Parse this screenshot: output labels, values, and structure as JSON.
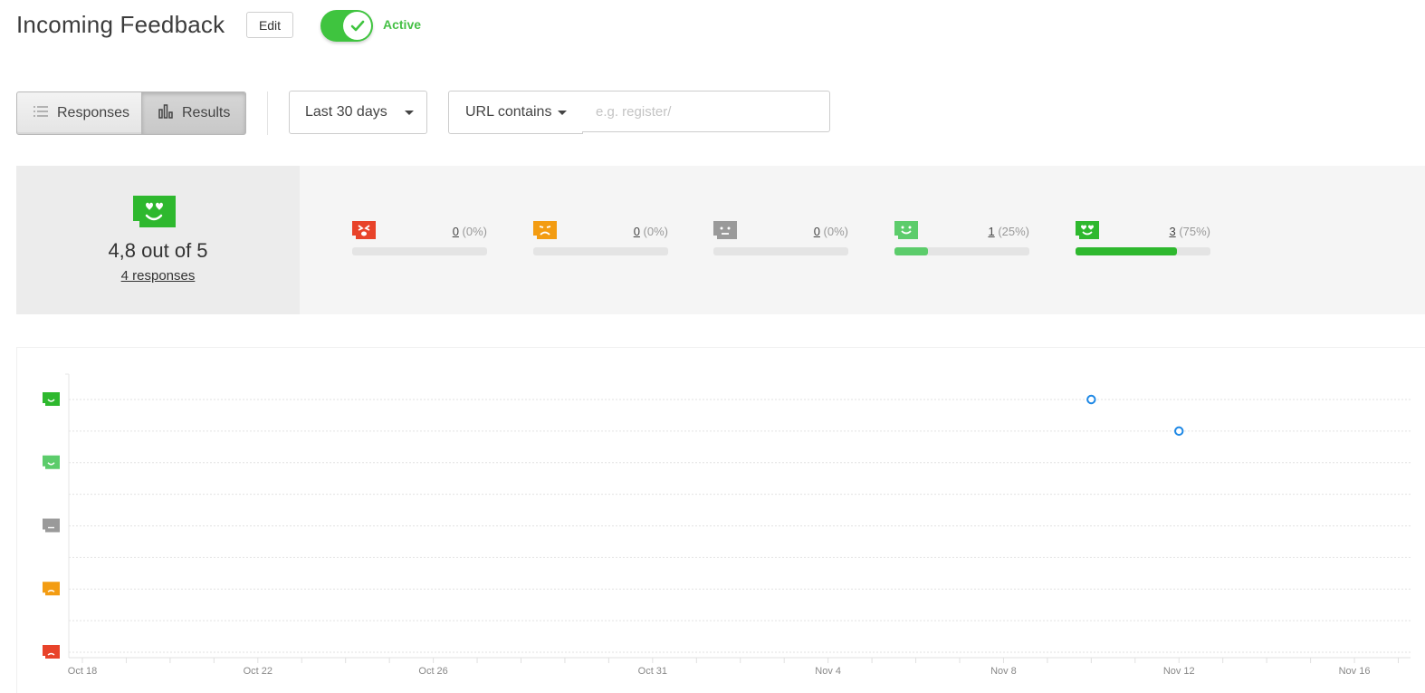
{
  "header": {
    "title": "Incoming Feedback",
    "edit_label": "Edit",
    "status_label": "Active",
    "active_color": "#3fc43f"
  },
  "toolbar": {
    "responses_tab": "Responses",
    "results_tab": "Results",
    "date_range": "Last 30 days",
    "url_filter": "URL contains",
    "url_placeholder": "e.g. register/"
  },
  "summary": {
    "average": "4,8",
    "average_suffix": "out of 5",
    "responses_link": "4 responses",
    "ratings": [
      {
        "name": "angry",
        "color": "#e8432a",
        "count": "0",
        "pct": "(0%)",
        "fraction": 0
      },
      {
        "name": "sad",
        "color": "#f39c12",
        "count": "0",
        "pct": "(0%)",
        "fraction": 0
      },
      {
        "name": "neutral",
        "color": "#9a9a9a",
        "count": "0",
        "pct": "(0%)",
        "fraction": 0
      },
      {
        "name": "happy",
        "color": "#5ccc6b",
        "count": "1",
        "pct": "(25%)",
        "fraction": 0.25
      },
      {
        "name": "love",
        "color": "#2eb82e",
        "count": "3",
        "pct": "(75%)",
        "fraction": 0.75
      }
    ]
  },
  "chart_data": {
    "type": "scatter",
    "x_ticks": [
      "Oct 18",
      "Oct 22",
      "Oct 26",
      "Oct 31",
      "Nov 4",
      "Nov 8",
      "Nov 12",
      "Nov 16"
    ],
    "xlim": [
      "2016-10-18",
      "2016-11-17"
    ],
    "ylim": [
      1,
      5
    ],
    "y_levels": [
      "angry",
      "sad",
      "neutral",
      "happy",
      "love"
    ],
    "points": [
      {
        "x": "2016-11-10",
        "y": 5
      },
      {
        "x": "2016-11-12",
        "y": 4.5
      }
    ],
    "point_color": "#1e88e5",
    "grid": true
  }
}
